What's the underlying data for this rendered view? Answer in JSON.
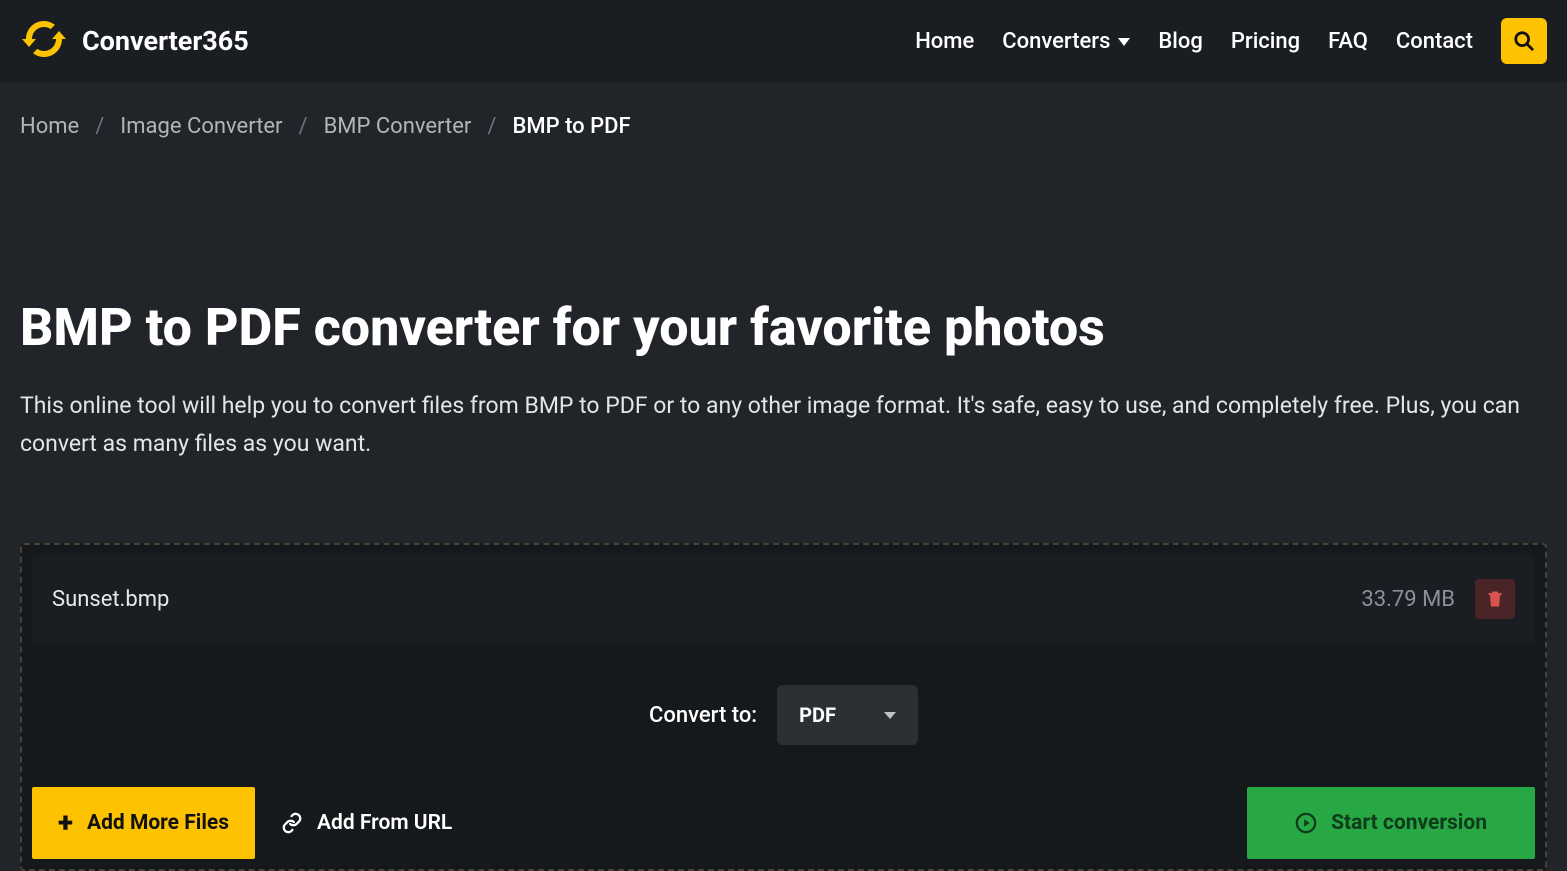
{
  "header": {
    "logo_text": "Converter365",
    "nav": {
      "home": "Home",
      "converters": "Converters",
      "blog": "Blog",
      "pricing": "Pricing",
      "faq": "FAQ",
      "contact": "Contact"
    }
  },
  "breadcrumb": {
    "items": [
      "Home",
      "Image Converter",
      "BMP Converter"
    ],
    "current": "BMP to PDF"
  },
  "hero": {
    "title": "BMP to PDF converter for your favorite photos",
    "description": "This online tool will help you to convert files from BMP to PDF or to any other image format. It's safe, easy to use, and completely free. Plus, you can convert as many files as you want."
  },
  "file": {
    "name": "Sunset.bmp",
    "size": "33.79 MB"
  },
  "convert": {
    "label": "Convert to:",
    "format": "PDF"
  },
  "actions": {
    "add_more": "Add More Files",
    "add_url": "Add From URL",
    "start": "Start conversion"
  }
}
